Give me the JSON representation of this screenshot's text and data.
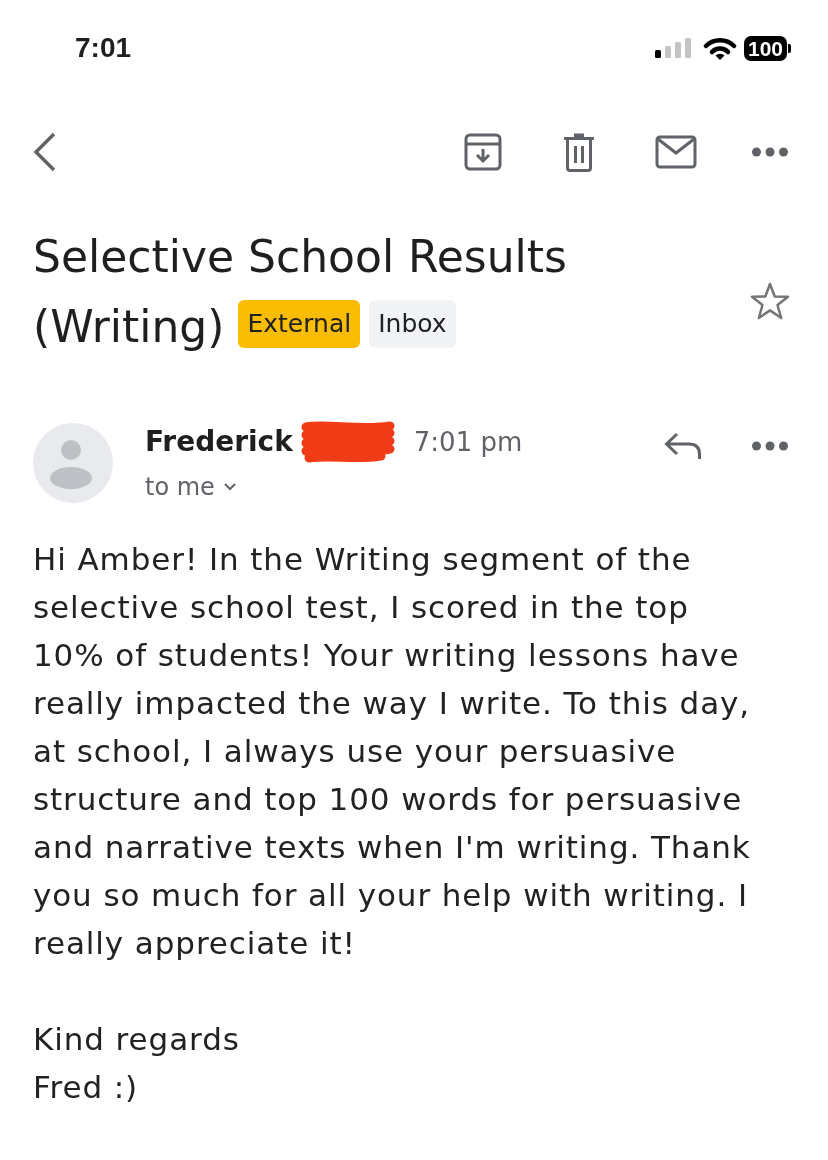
{
  "status_bar": {
    "time": "7:01",
    "battery": "100"
  },
  "subject": {
    "title_lines": [
      "Selective School Results",
      "(Writing)"
    ],
    "labels": [
      {
        "text": "External",
        "color": "#fbbc04"
      },
      {
        "text": "Inbox",
        "color": "#f1f3f4"
      }
    ],
    "starred": false
  },
  "message": {
    "sender": "Frederick",
    "sender_redacted": true,
    "time": "7:01 pm",
    "recipient": "to me",
    "body": "Hi Amber! In the Writing segment of the selective school test, I scored in the top 10% of students! Your writing lessons have really impacted the way I write. To this day, at school, I always use your persuasive structure and top 100 words for persuasive and narrative texts when I'm writing. Thank you so much for all your help with writing. I really appreciate it!",
    "closing": "Kind regards",
    "signature": "Fred :)"
  }
}
